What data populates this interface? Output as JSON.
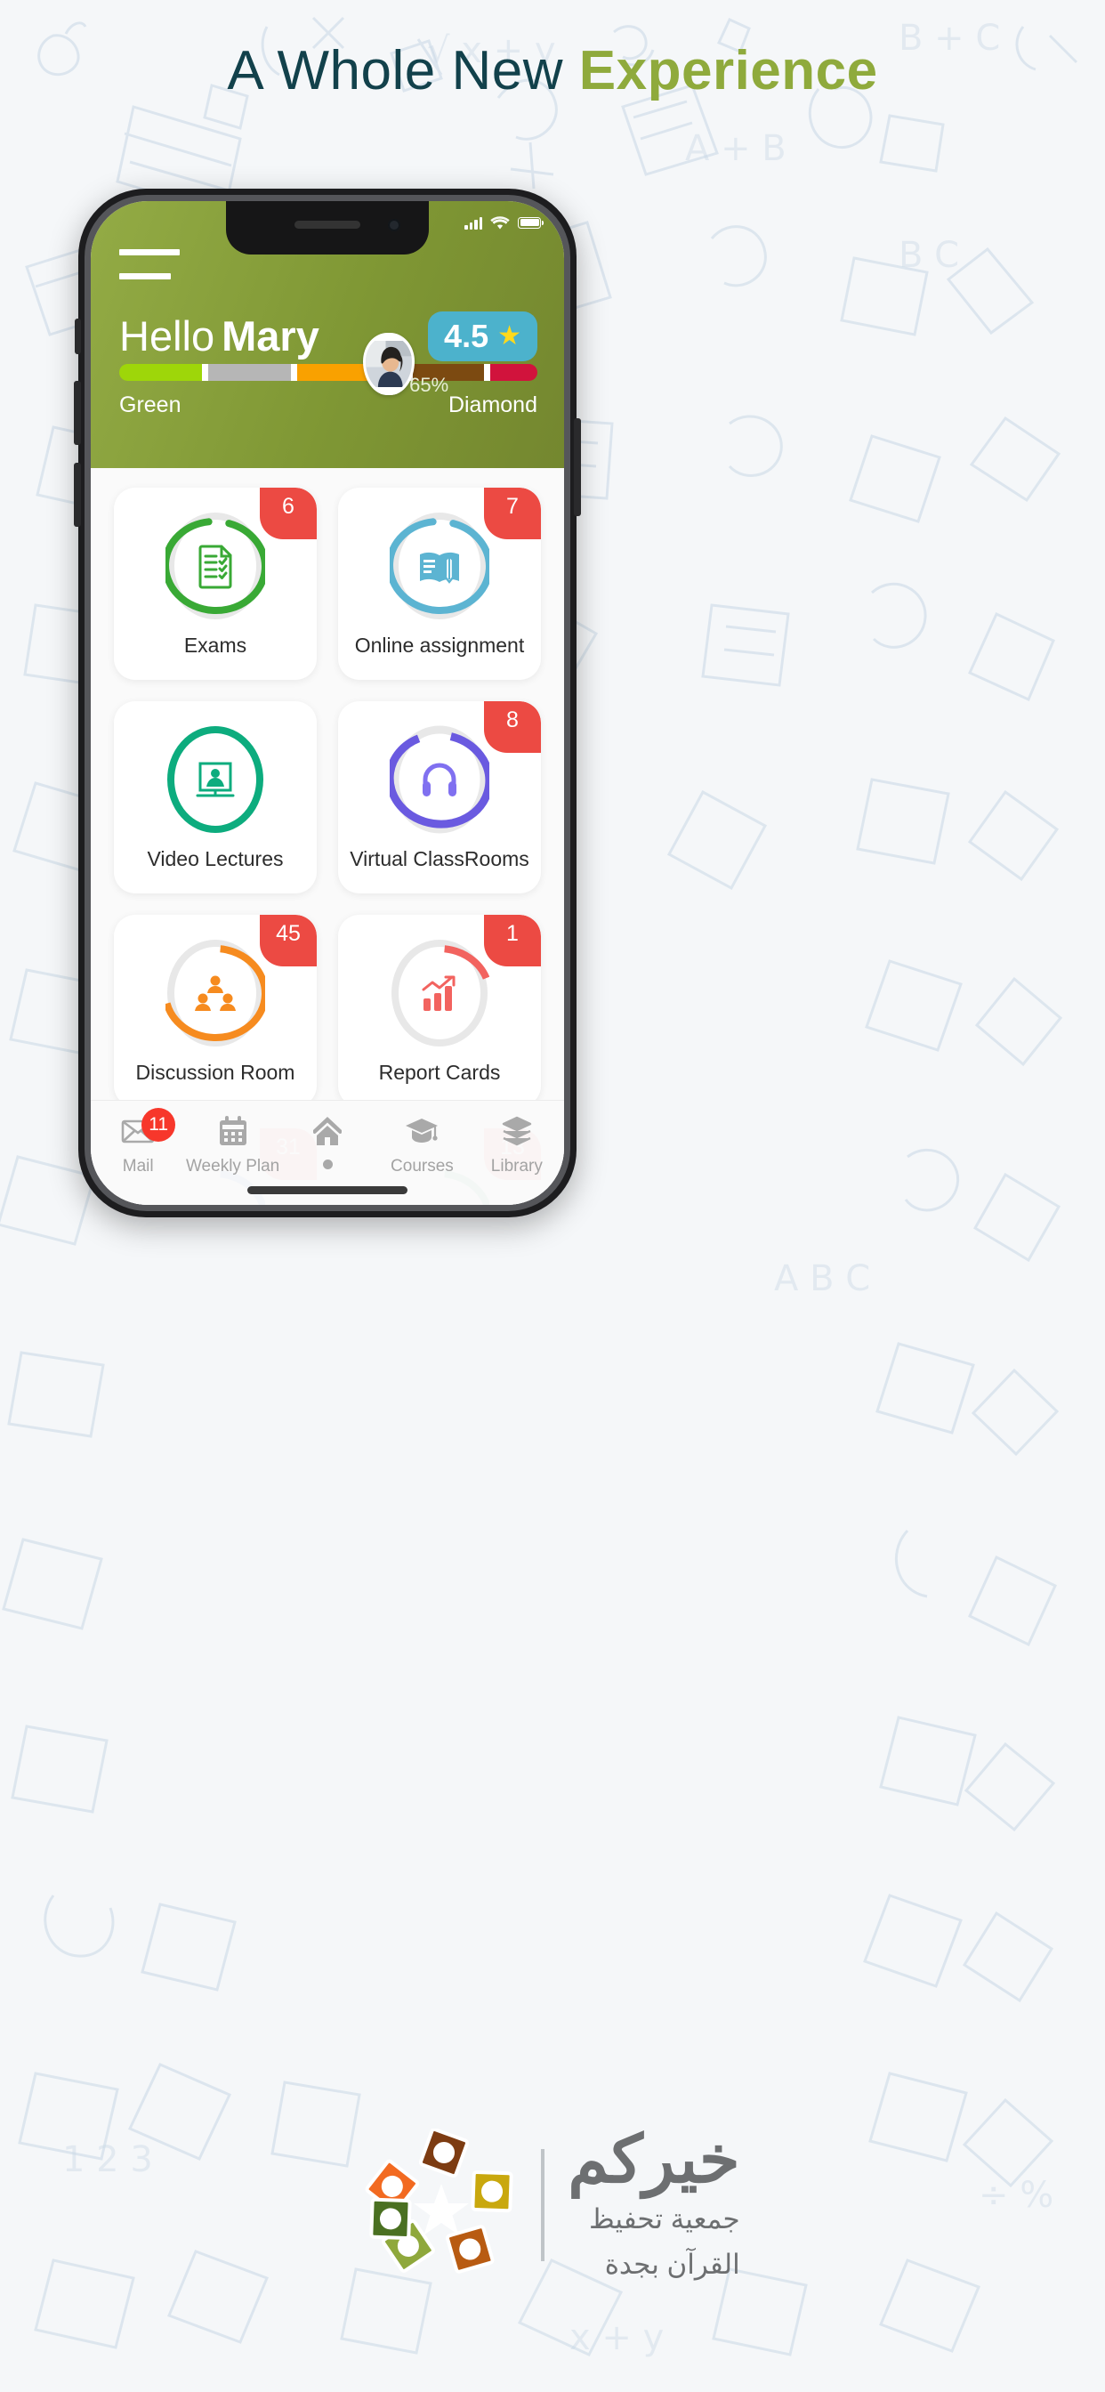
{
  "headline": {
    "light": "A Whole New",
    "bold": "Experience"
  },
  "statusbar": {
    "signal_icon": "signal-bars-icon",
    "wifi_icon": "wifi-icon",
    "battery_icon": "battery-full-icon"
  },
  "header": {
    "menu_icon": "hamburger-menu-icon",
    "greeting_light": "Hello",
    "greeting_name": "Mary",
    "rating_value": "4.5",
    "rating_star_icon": "star-icon",
    "progress": {
      "percent_label": "65%",
      "percent_value": 65,
      "left_label": "Green",
      "right_label": "Diamond",
      "avatar_icon": "user-avatar-photo",
      "segments": [
        {
          "name": "green",
          "color": "#9ed609",
          "width": 21
        },
        {
          "name": "silver",
          "color": "#b6b6b6",
          "width": 21
        },
        {
          "name": "gold",
          "color": "#f9a100",
          "width": 28
        },
        {
          "name": "bronze",
          "color": "#7c4a11",
          "width": 18
        },
        {
          "name": "diamond",
          "color": "#d1133c",
          "width": 12
        }
      ]
    }
  },
  "cards": [
    {
      "label": "Exams",
      "badge": "6",
      "color": "#39a935",
      "icon": "checklist-document-icon",
      "progress": 92
    },
    {
      "label": "Online assignment",
      "badge": "7",
      "color": "#5cb4d2",
      "icon": "book-pencil-icon",
      "progress": 92
    },
    {
      "label": "Video Lectures",
      "badge": "",
      "color": "#0dac7e",
      "icon": "video-lecture-icon",
      "progress": 100
    },
    {
      "label": "Virtual ClassRooms",
      "badge": "8",
      "color": "#6a5ae0",
      "icon": "headphones-icon",
      "progress": 88
    },
    {
      "label": "Discussion Room",
      "badge": "45",
      "color": "#f68b1f",
      "icon": "group-discussion-icon",
      "progress": 70
    },
    {
      "label": "Report Cards",
      "badge": "1",
      "color": "#f2635f",
      "icon": "bar-chart-growth-icon",
      "progress": 18
    },
    {
      "label": "",
      "badge": "31",
      "color": "#3f7fd0",
      "icon": "partial-card-icon",
      "progress": 62
    },
    {
      "label": "",
      "badge": "13",
      "color": "#2f8f6a",
      "icon": "partial-card-icon",
      "progress": 55
    }
  ],
  "bottom_nav": [
    {
      "label": "Mail",
      "icon": "mail-envelope-icon",
      "badge": "11",
      "active": false
    },
    {
      "label": "Weekly Plan",
      "icon": "calendar-icon",
      "badge": "",
      "active": false
    },
    {
      "label": "",
      "icon": "home-icon",
      "badge": "",
      "active": true
    },
    {
      "label": "Courses",
      "icon": "graduation-cap-icon",
      "badge": "",
      "active": false
    },
    {
      "label": "Library",
      "icon": "books-stack-icon",
      "badge": "",
      "active": false
    }
  ],
  "footer": {
    "logo_icon": "khairakum-star-logo",
    "title": "خيركم",
    "subtitle_line1": "جمعية تحفيظ",
    "subtitle_line2": "القرآن بجدة"
  }
}
